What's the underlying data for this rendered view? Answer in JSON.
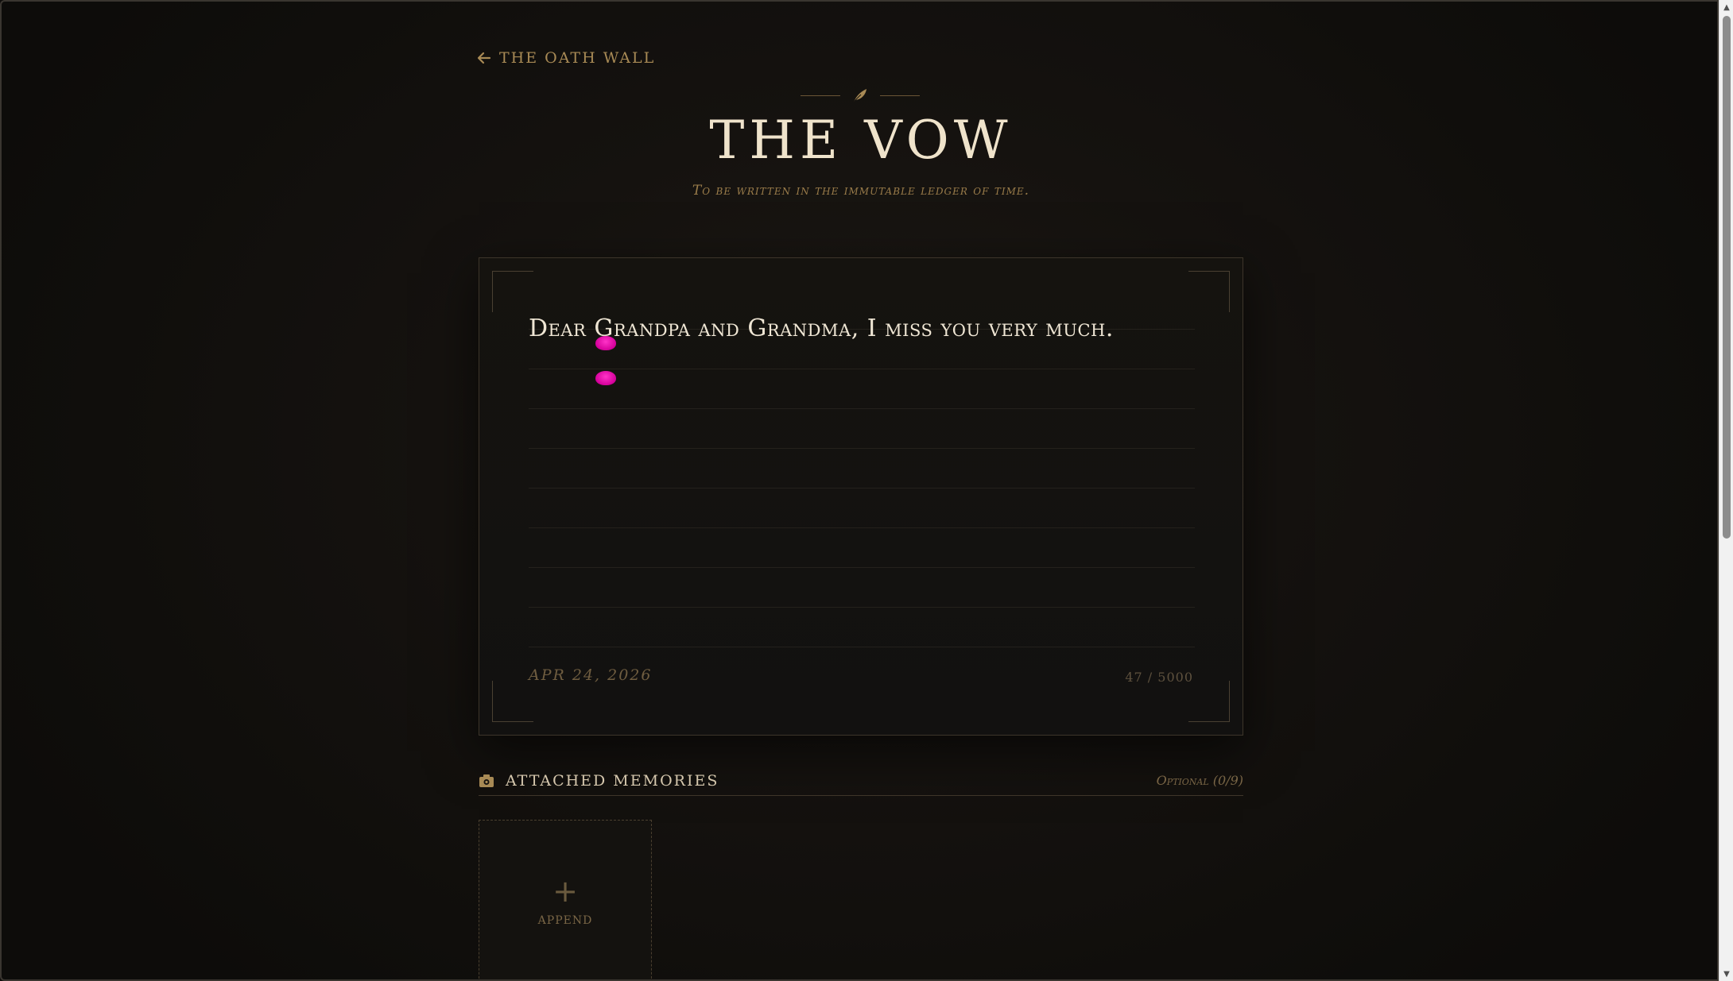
{
  "nav": {
    "back_label": "The Oath Wall"
  },
  "header": {
    "title": "THE VOW",
    "subtitle": "To be written in the immutable ledger of time."
  },
  "editor": {
    "text": "Dear Grandpa and Grandma, I miss you very much.",
    "date": "APR 24, 2026",
    "counter": "47 / 5000"
  },
  "memories": {
    "title": "Attached Memories",
    "optional": "Optional (0/9)",
    "append_label": "Append",
    "append_symbol": "+"
  },
  "colors": {
    "accent": "#a88a55",
    "background": "#15120f",
    "highlight_blob": "#e600b0"
  },
  "icons": {
    "back": "arrow-left-icon",
    "ornament": "feather-icon",
    "memories": "camera-icon"
  }
}
